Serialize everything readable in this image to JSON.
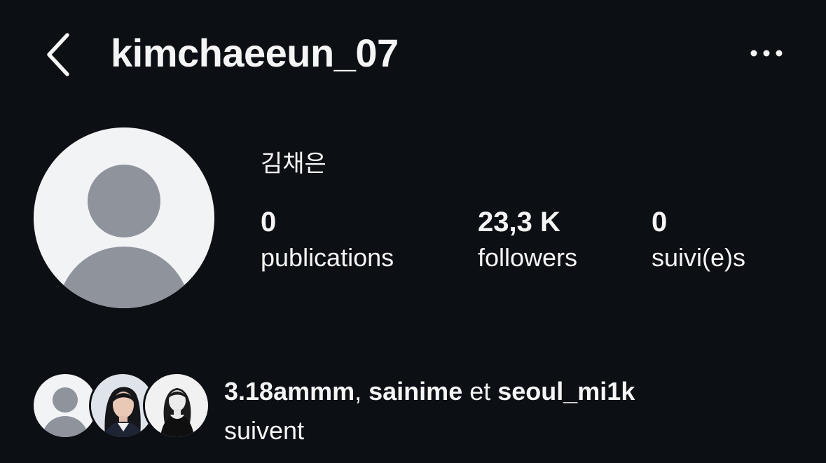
{
  "header": {
    "username": "kimchaeeun_07",
    "back_icon": "chevron-left-icon",
    "more_icon": "more-horizontal-icon"
  },
  "profile": {
    "display_name": "김채은",
    "avatar_icon": "default-avatar-icon",
    "stats": {
      "posts_count": "0",
      "posts_label": "publications",
      "followers_count": "23,3 K",
      "followers_label": "followers",
      "following_count": "0",
      "following_label": "suivi(e)s"
    }
  },
  "mutuals": {
    "user1": "3.18ammm",
    "sep1": ", ",
    "user2": "sainime",
    "sep2": " et ",
    "user3": "seoul_mi1k",
    "suffix": "suivent"
  },
  "colors": {
    "background": "#0c0f14",
    "text": "#f5f5f5",
    "avatar_bg": "#f2f3f5",
    "avatar_figure": "#8e939c"
  }
}
